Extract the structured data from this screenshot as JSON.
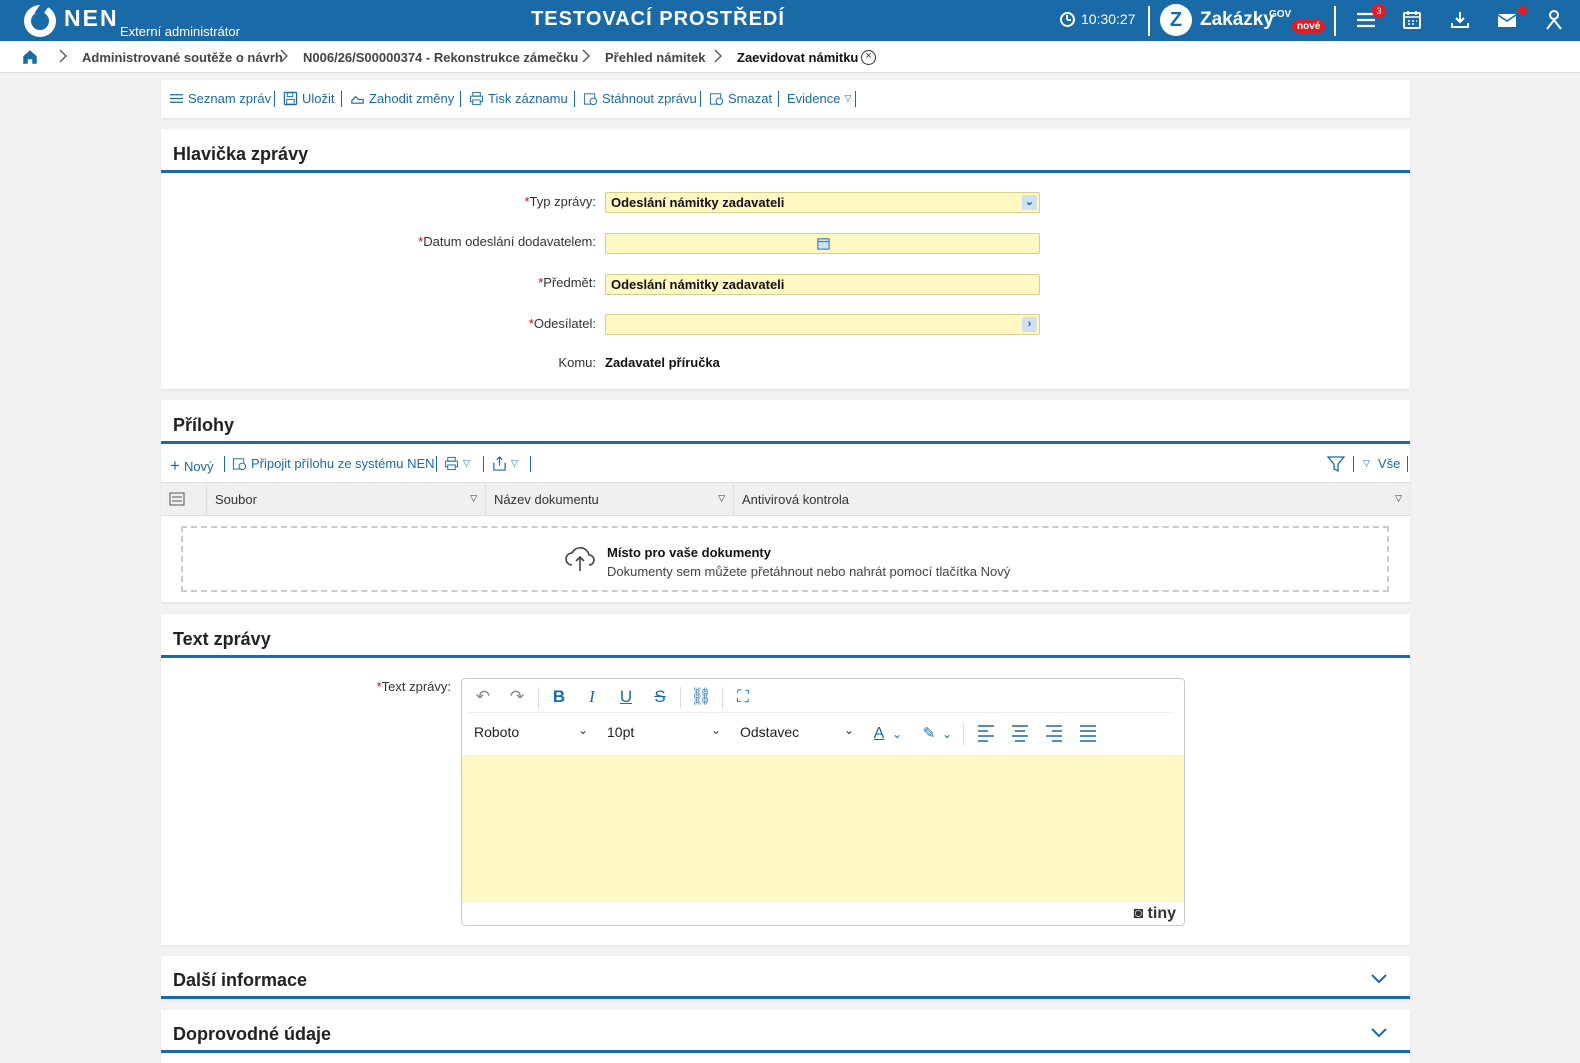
{
  "topbar": {
    "logo": "NEN",
    "role": "Externí administrátor",
    "environment": "TESTOVACÍ PROSTŘEDÍ",
    "time": "10:30:27",
    "zakazky": "Zakázky",
    "gov": "GOV",
    "nove": "nové",
    "notification_count": "3",
    "brand_color": "#1a6aa8"
  },
  "breadcrumb": {
    "items": [
      "Administrované soutěže o návrh",
      "N006/26/S00000374 - Rekonstrukce zámečku",
      "Přehled námitek",
      "Zaevidovat námitku"
    ]
  },
  "toolbar": {
    "items": [
      "Seznam zpráv",
      "Uložit",
      "Zahodit změny",
      "Tisk záznamu",
      "Stáhnout zprávu",
      "Smazat",
      "Evidence"
    ]
  },
  "header_section": {
    "title": "Hlavička zprávy",
    "fields": {
      "typ_label": "Typ zprávy:",
      "typ_value": "Odeslání námitky zadavateli",
      "datum_label": "Datum odeslání dodavatelem:",
      "datum_value": "",
      "predmet_label": "Předmět:",
      "predmet_value": "Odeslání námitky zadavateli",
      "odesilatel_label": "Odesílatel:",
      "odesilatel_value": "",
      "komu_label": "Komu:",
      "komu_value": "Zadavatel příručka"
    },
    "required_mark": "*",
    "field_color": "#fff8c3"
  },
  "attachments": {
    "title": "Přílohy",
    "new_label": "Nový",
    "attach_label": "Připojit přílohu ze systému NEN",
    "filter_all": "Vše",
    "columns": [
      "Soubor",
      "Název dokumentu",
      "Antivirová kontrola"
    ],
    "drop_title": "Místo pro vaše dokumenty",
    "drop_sub": "Dokumenty sem můžete přetáhnout nebo nahrát pomocí tlačítka Nový"
  },
  "text_section": {
    "title": "Text zprávy",
    "label": "Text zprávy:",
    "font": "Roboto",
    "size": "10pt",
    "block": "Odstavec",
    "brand": "tiny"
  },
  "collapsed": {
    "dalsi": "Další informace",
    "doprovodne": "Doprovodné údaje"
  }
}
